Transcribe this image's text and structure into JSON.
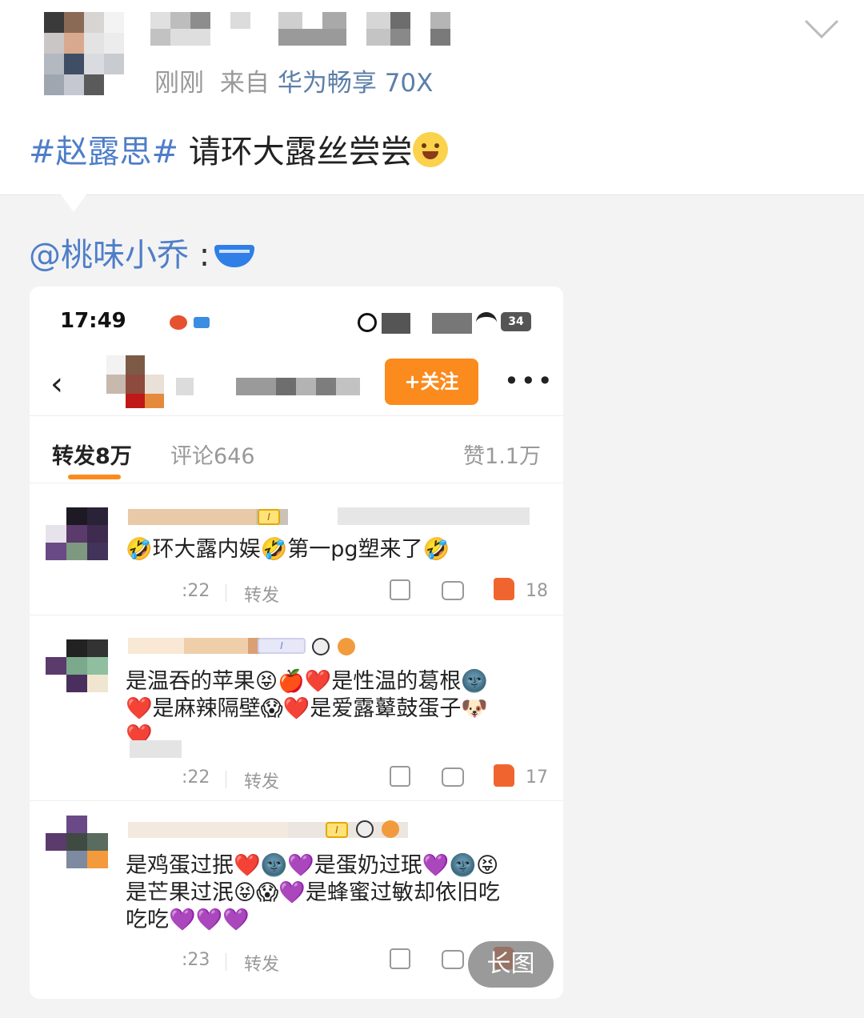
{
  "post": {
    "time": "刚刚",
    "from_label": "来自",
    "device": "华为畅享 70X",
    "text_tag": "#赵露思#",
    "text_body": " 请环大露丝尝尝",
    "text_emoji": "hugging-face-icon"
  },
  "repost": {
    "mention": "@桃味小乔",
    "separator": " :",
    "emoji": "briefs-icon"
  },
  "screenshot": {
    "status_time": "17:49",
    "battery": "34",
    "follow_label": "+关注",
    "tabs": {
      "repost": "转发8万",
      "comment": "评论646",
      "like": "赞1.1万"
    },
    "comments": [
      {
        "text": "🤣环大露内娱🤣第一pg塑来了🤣",
        "time": ":22",
        "repost_label": "转发",
        "likes": "18"
      },
      {
        "text_line1": "是温吞的苹果😝🍎❤️是性温的葛根🌚",
        "text_line2": "❤️是麻辣隔壁😱❤️是爱露鼙鼓蛋子🐶",
        "text_line3": "❤️",
        "time": ":22",
        "repost_label": "转发",
        "likes": "17"
      },
      {
        "text_line1": "是鸡蛋过抿❤️🌚💜是蛋奶过珉💜🌚😝",
        "text_line2": "是芒果过泯😝😱💜是蜂蜜过敏却依旧吃",
        "text_line3": "吃吃💜💜💜",
        "time": ":23",
        "repost_label": "转发"
      }
    ]
  },
  "long_image_label": "长图",
  "colors": {
    "link_blue": "#4f7ec9",
    "follow_orange": "#fb8b1d",
    "like_orange": "#f0652f"
  }
}
